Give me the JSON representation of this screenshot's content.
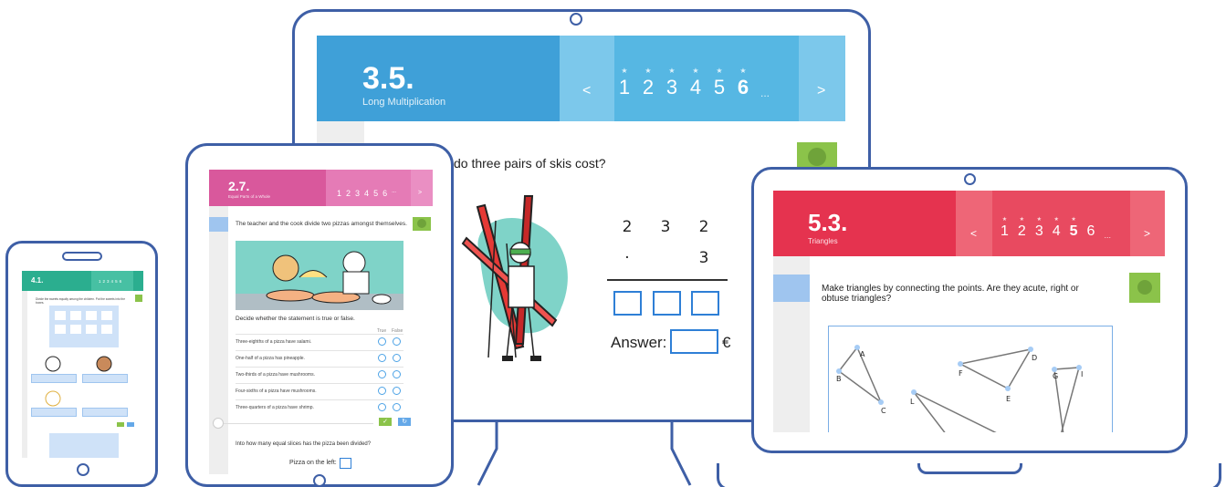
{
  "monitor": {
    "lesson_number": "3.5.",
    "lesson_title": "Long Multiplication",
    "prev_label": "<",
    "next_label": ">",
    "pages": [
      "1",
      "2",
      "3",
      "4",
      "5",
      "6"
    ],
    "page_more": "...",
    "active_page": "6",
    "question": "...do three pairs of skis cost?",
    "question_visible": "do three pairs of skis cost?",
    "multiplicand_digits": [
      "2",
      "3",
      "2"
    ],
    "operator": "·",
    "multiplier": "3",
    "answer_label": "Answer:",
    "currency": "€",
    "colors": {
      "banner": "#3fa0d8",
      "pager": "#56b7e3",
      "accent": "#2e7fd6"
    }
  },
  "tablet": {
    "lesson_number": "2.7.",
    "lesson_title": "Equal Parts of a Whole",
    "pages": [
      "1",
      "2",
      "3",
      "4",
      "5",
      "6"
    ],
    "page_more": "...",
    "next_label": ">",
    "intro": "The teacher and the cook divide two pizzas amongst themselves.",
    "instruction": "Decide whether the statement is true or false.",
    "col_true": "True",
    "col_false": "False",
    "statements": [
      "Three-eighths of a pizza have salami.",
      "One-half of a pizza has pineapple.",
      "Two-thirds of a pizza have mushrooms.",
      "Four-sixths of a pizza have mushrooms.",
      "Three-quarters of a pizza have shrimp."
    ],
    "question2": "Into how many equal slices has the pizza been divided?",
    "answer_prompt": "Pizza on the left:",
    "colors": {
      "banner": "#d9589c",
      "pager": "#e57bb6"
    }
  },
  "laptop": {
    "lesson_number": "5.3.",
    "lesson_title": "Triangles",
    "prev_label": "<",
    "next_label": ">",
    "pages": [
      "1",
      "2",
      "3",
      "4",
      "5",
      "6"
    ],
    "page_more": "...",
    "active_page": "5",
    "question": "Make triangles by connecting the points. Are they acute, right or obtuse triangles?",
    "points": [
      "A",
      "B",
      "C",
      "D",
      "E",
      "F",
      "G",
      "I",
      "L"
    ],
    "colors": {
      "banner": "#e5334f",
      "pager": "#ee5a6e"
    }
  },
  "phone": {
    "lesson_number": "4.1.",
    "pages": [
      "1",
      "2",
      "3",
      "4",
      "5",
      "6"
    ],
    "instruction": "Divide the sweets equally among the children. Put the sweets into the boxes.",
    "colors": {
      "banner": "#2bae8f"
    }
  }
}
